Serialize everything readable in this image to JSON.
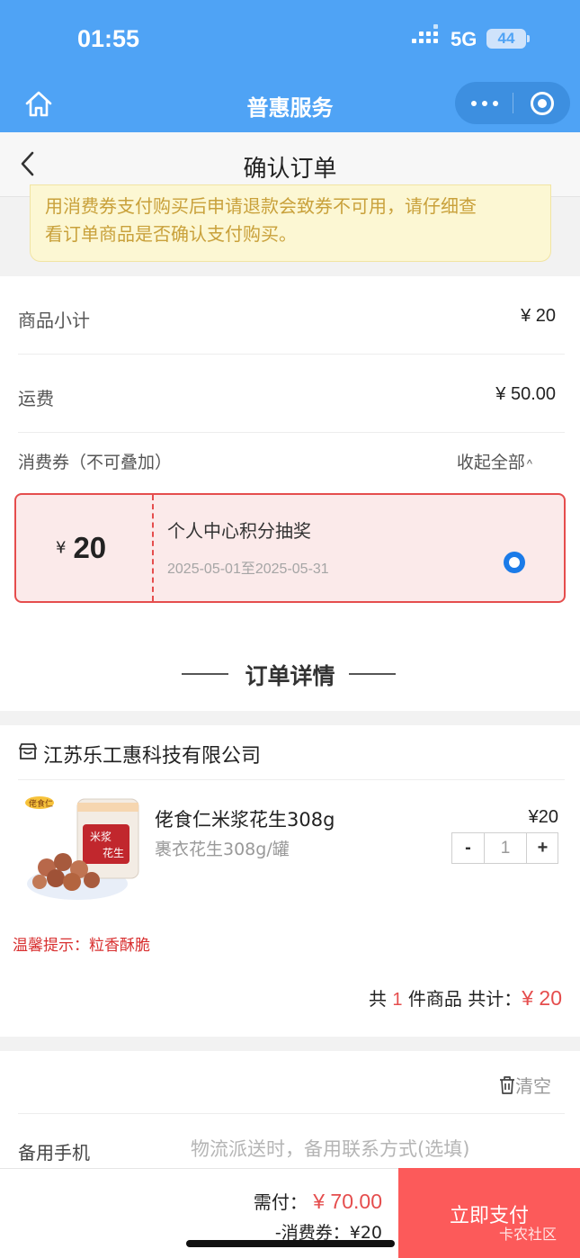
{
  "status_bar": {
    "time": "01:55",
    "network": "5G",
    "battery": "44"
  },
  "nav": {
    "title": "普惠服务"
  },
  "page": {
    "title": "确认订单"
  },
  "notice": {
    "line1": "用消费券支付购买后申请退款会致券不可用，请仔细查",
    "line2": "看订单商品是否确认支付购买。"
  },
  "costs": {
    "subtotal_label": "商品小计",
    "subtotal_value": "¥ 20",
    "shipping_label": "运费",
    "shipping_value": "¥ 50.00"
  },
  "coupons": {
    "label": "消费券（不可叠加）",
    "collapse_label": "收起全部",
    "collapse_icon": "chevron-up-icon",
    "selected": {
      "currency": "¥",
      "amount": "20",
      "name": "个人中心积分抽奖",
      "validity": "2025-05-01至2025-05-31",
      "checked": true
    }
  },
  "order_details": {
    "title": "订单详情",
    "shop_name": "江苏乐工惠科技有限公司",
    "product": {
      "name": "佬食仁米浆花生308g",
      "spec": "裹衣花生308g/罐",
      "price": "¥20",
      "quantity": "1",
      "minus": "-",
      "plus": "+",
      "image_text": "米浆花生",
      "brand_text": "佬食仁"
    },
    "tip": "温馨提示：粒香酥脆",
    "summary_prefix": "共",
    "summary_count": "1",
    "summary_mid": "件商品 共计：",
    "summary_total": "¥ 20"
  },
  "contact": {
    "clear_label": "清空",
    "phone_label": "备用手机",
    "phone_placeholder": "物流派送时，备用联系方式(选填)"
  },
  "footer": {
    "due_label": "需付：",
    "due_value": "¥ 70.00",
    "deduct": "-消费券：¥20",
    "pay_button": "立即支付",
    "watermark": "卡农社区"
  },
  "colors": {
    "primary_blue": "#4fa3f5",
    "accent_red": "#e54d4d",
    "pay_button": "#fc5a5a",
    "notice_bg": "#fcf7d3"
  }
}
